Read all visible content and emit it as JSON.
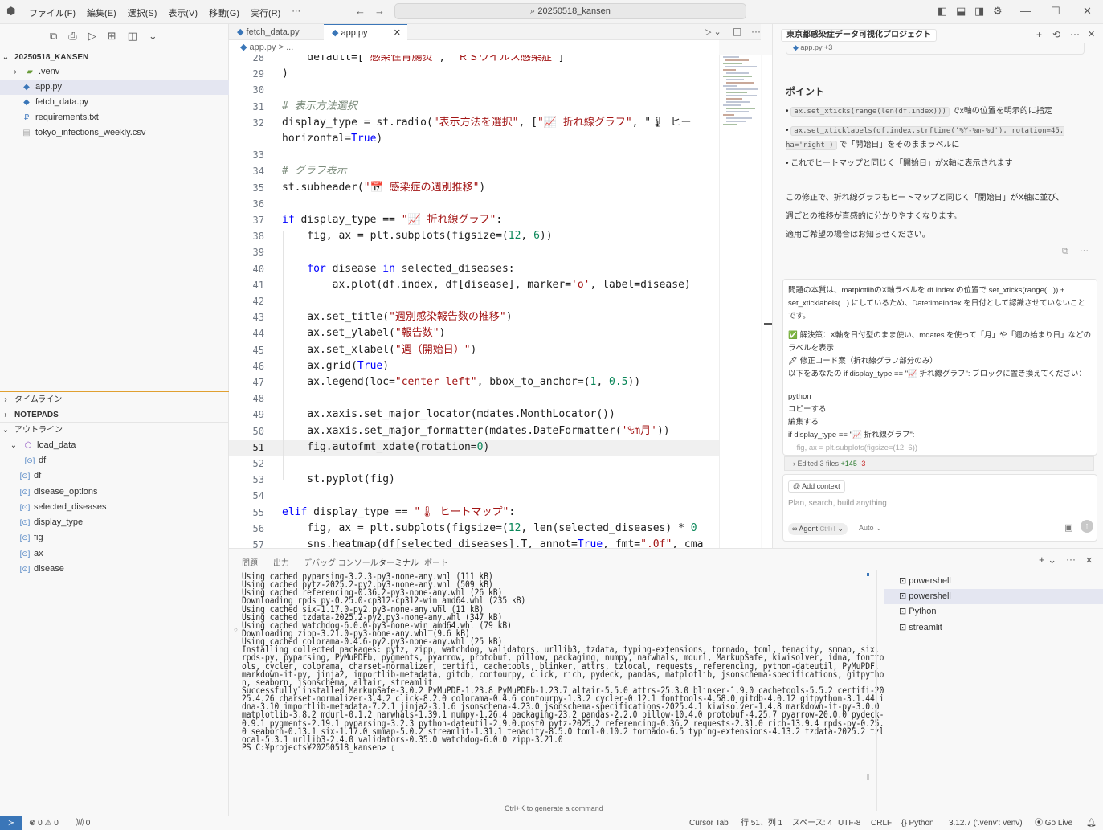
{
  "titlebar": {
    "menus": [
      "ファイル(F)",
      "編集(E)",
      "選択(S)",
      "表示(V)",
      "移動(G)",
      "実行(R)",
      "···"
    ],
    "search": "20250518_kansen"
  },
  "sidebar": {
    "root": "20250518_KANSEN",
    "files": [
      {
        "name": ".venv",
        "icon": "folder-icon"
      },
      {
        "name": "app.py",
        "icon": "python-file-icon"
      },
      {
        "name": "fetch_data.py",
        "icon": "python-file-icon"
      },
      {
        "name": "requirements.txt",
        "icon": "text-file-icon"
      },
      {
        "name": "tokyo_infections_weekly.csv",
        "icon": "csv-file-icon"
      }
    ],
    "timeline": "タイムライン",
    "notepads": "NOTEPADS",
    "outline": "アウトライン",
    "outline_items": [
      "load_data",
      "df",
      "df",
      "disease_options",
      "selected_diseases",
      "display_type",
      "fig",
      "ax",
      "disease"
    ]
  },
  "tabs": [
    {
      "label": "fetch_data.py"
    },
    {
      "label": "app.py"
    }
  ],
  "breadcrumb": {
    "file": "app.py",
    "rest": "> ..."
  },
  "editor": {
    "lines": [
      {
        "n": "28",
        "t": "    default=[\"感染性胃腸炎\", \"ＲＳウイルス感染症\"]"
      },
      {
        "n": "29",
        "t": ")"
      },
      {
        "n": "30",
        "t": ""
      },
      {
        "n": "31",
        "t": "# 表示方法選択"
      },
      {
        "n": "32",
        "t": "display_type = st.radio(\"表示方法を選択\", [\"📈 折れ線グラフ\", \"🌡 ヒー"
      },
      {
        "n": "",
        "t": "horizontal=True)"
      },
      {
        "n": "33",
        "t": ""
      },
      {
        "n": "34",
        "t": "# グラフ表示"
      },
      {
        "n": "35",
        "t": "st.subheader(\"📅 感染症の週別推移\")"
      },
      {
        "n": "36",
        "t": ""
      },
      {
        "n": "37",
        "t": "if display_type == \"📈 折れ線グラフ\":"
      },
      {
        "n": "38",
        "t": "    fig, ax = plt.subplots(figsize=(12, 6))"
      },
      {
        "n": "39",
        "t": ""
      },
      {
        "n": "40",
        "t": "    for disease in selected_diseases:"
      },
      {
        "n": "41",
        "t": "        ax.plot(df.index, df[disease], marker='o', label=disease)"
      },
      {
        "n": "42",
        "t": ""
      },
      {
        "n": "43",
        "t": "    ax.set_title(\"週別感染報告数の推移\")"
      },
      {
        "n": "44",
        "t": "    ax.set_ylabel(\"報告数\")"
      },
      {
        "n": "45",
        "t": "    ax.set_xlabel(\"週（開始日）\")"
      },
      {
        "n": "46",
        "t": "    ax.grid(True)"
      },
      {
        "n": "47",
        "t": "    ax.legend(loc=\"center left\", bbox_to_anchor=(1, 0.5))"
      },
      {
        "n": "48",
        "t": ""
      },
      {
        "n": "49",
        "t": "    ax.xaxis.set_major_locator(mdates.MonthLocator())"
      },
      {
        "n": "50",
        "t": "    ax.xaxis.set_major_formatter(mdates.DateFormatter('%m月'))"
      },
      {
        "n": "51",
        "t": "    fig.autofmt_xdate(rotation=0)"
      },
      {
        "n": "52",
        "t": ""
      },
      {
        "n": "53",
        "t": "    st.pyplot(fig)"
      },
      {
        "n": "54",
        "t": ""
      },
      {
        "n": "55",
        "t": "elif display_type == \"🌡 ヒートマップ\":"
      },
      {
        "n": "56",
        "t": "    fig, ax = plt.subplots(figsize=(12, len(selected_diseases) * 0"
      },
      {
        "n": "57",
        "t": "    sns.heatmap(df[selected_diseases].T, annot=True, fmt=\".0f\", cma"
      }
    ]
  },
  "chat": {
    "title": "東京都感染症データ可視化プロジェクト",
    "file_chip": "app.py +3",
    "point_heading": "ポイント",
    "bullet1_code": "ax.set_xticks(range(len(df.index)))",
    "bullet1_text": "でx軸の位置を明示的に指定",
    "bullet2_code": "ax.set_xticklabels(df.index.strftime('%Y-%m-%d'), rotation=45, ha='right')",
    "bullet2_text": "で「開始日」をそのままラベルに",
    "bullet3": "これでヒートマップと同じく「開始日」がX軸に表示されます",
    "para1": "この修正で、折れ線グラフもヒートマップと同じく「開始日」がX軸に並び、",
    "para2": "週ごとの推移が直感的に分かりやすくなります。",
    "para3": "適用ご希望の場合はお知らせください。",
    "user_msg1": "問題の本質は、matplotlibのX軸ラベルを df.index の位置で set_xticks(range(...)) + set_xticklabels(...) にしているため、DatetimeIndex を日付として認識させていないことです。",
    "user_msg2": "✅ 解決策：X軸を日付型のまま使い、mdates を使って「月」や「週の始まり日」などのラベルを表示",
    "user_msg3": "🖋 修正コード案（折れ線グラフ部分のみ）",
    "user_msg4": "以下をあなたの if display_type == \"📈 折れ線グラフ\": ブロックに置き換えてください：",
    "user_msg5": "python",
    "user_msg6": "コピーする",
    "user_msg7": "編集する",
    "user_msg8": "if display_type == \"📈 折れ線グラフ\":",
    "user_msg9": "    fig, ax = plt.subplots(figsize=(12, 6))",
    "edited": "Edited 3 files",
    "edited_add": "+145",
    "edited_del": "-3",
    "add_context": "Add context",
    "placeholder": "Plan, search, build anything",
    "agent": "Agent",
    "agent_shortcut": "Ctrl+I",
    "auto": "Auto"
  },
  "panel": {
    "tabs": [
      "問題",
      "出力",
      "デバッグ コンソール",
      "ターミナル",
      "ポート"
    ],
    "terminal_lines": [
      "Using cached pyparsing-3.2.3-py3-none-any.whl (111 kB)",
      "Using cached pytz-2025.2-py2.py3-none-any.whl (509 kB)",
      "Using cached referencing-0.36.2-py3-none-any.whl (26 kB)",
      "Downloading rpds_py-0.25.0-cp312-cp312-win_amd64.whl (235 kB)",
      "Using cached six-1.17.0-py2.py3-none-any.whl (11 kB)",
      "Using cached tzdata-2025.2-py2.py3-none-any.whl (347 kB)",
      "Using cached watchdog-6.0.0-py3-none-win_amd64.whl (79 kB)",
      "Downloading zipp-3.21.0-py3-none-any.whl (9.6 kB)",
      "Using cached colorama-0.4.6-py2.py3-none-any.whl (25 kB)",
      "Installing collected packages: pytz, zipp, watchdog, validators, urllib3, tzdata, typing-extensions, tornado, toml, tenacity, smmap, six,",
      "rpds-py, pyparsing, PyMuPDFb, pygments, pyarrow, protobuf, pillow, packaging, numpy, narwhals, mdurl, MarkupSafe, kiwisolver, idna, fontto",
      "ols, cycler, colorama, charset-normalizer, certifi, cachetools, blinker, attrs, tzlocal, requests, referencing, python-dateutil, PyMuPDF,",
      "markdown-it-py, jinja2, importlib-metadata, gitdb, contourpy, click, rich, pydeck, pandas, matplotlib, jsonschema-specifications, gitpytho",
      "n, seaborn, jsonschema, altair, streamlit",
      "Successfully installed MarkupSafe-3.0.2 PyMuPDF-1.23.8 PyMuPDFb-1.23.7 altair-5.5.0 attrs-25.3.0 blinker-1.9.0 cachetools-5.5.2 certifi-20",
      "25.4.26 charset-normalizer-3.4.2 click-8.2.0 colorama-0.4.6 contourpy-1.3.2 cycler-0.12.1 fonttools-4.58.0 gitdb-4.0.12 gitpython-3.1.44 i",
      "dna-3.10 importlib-metadata-7.2.1 jinja2-3.1.6 jsonschema-4.23.0 jsonschema-specifications-2025.4.1 kiwisolver-1.4.8 markdown-it-py-3.0.0",
      "matplotlib-3.8.2 mdurl-0.1.2 narwhals-1.39.1 numpy-1.26.4 packaging-23.2 pandas-2.2.0 pillow-10.4.0 protobuf-4.25.7 pyarrow-20.0.0 pydeck-",
      "0.9.1 pygments-2.19.1 pyparsing-3.2.3 python-dateutil-2.9.0.post0 pytz-2025.2 referencing-0.36.2 requests-2.31.0 rich-13.9.4 rpds-py-0.25.",
      "0 seaborn-0.13.1 six-1.17.0 smmap-5.0.2 streamlit-1.31.1 tenacity-8.5.0 toml-0.10.2 tornado-6.5 typing-extensions-4.13.2 tzdata-2025.2 tzl",
      "ocal-5.3.1 urllib3-2.4.0 validators-0.35.0 watchdog-6.0.0 zipp-3.21.0",
      "PS C:¥projects¥20250518_kansen> ▯"
    ],
    "terminal_hint": "Ctrl+K to generate a command",
    "terminals": [
      "powershell",
      "powershell",
      "Python",
      "streamlit"
    ]
  },
  "status": {
    "errors": "⊗ 0 ⚠ 0",
    "ports": "🄦 0",
    "cursor_tab": "Cursor Tab",
    "position": "行 51、列 1",
    "spaces": "スペース: 4",
    "encoding": "UTF-8",
    "eol": "CRLF",
    "language": "Python",
    "interpreter": "3.12.7 ('.venv': venv)",
    "golive": "Go Live"
  }
}
